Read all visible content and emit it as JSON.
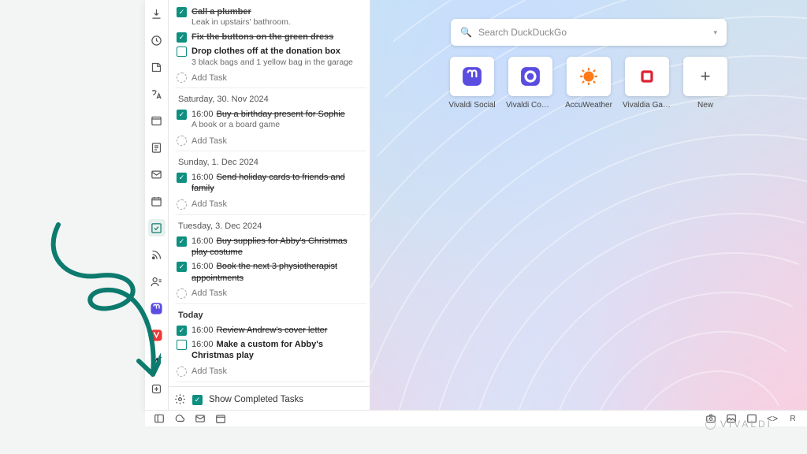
{
  "search": {
    "placeholder": "Search DuckDuckGo"
  },
  "speed_dial": [
    {
      "label": "Vivaldi Social",
      "icon": "mastodon"
    },
    {
      "label": "Vivaldi Com…",
      "icon": "vivaldi"
    },
    {
      "label": "AccuWeather",
      "icon": "sun"
    },
    {
      "label": "Vivaldia Games",
      "icon": "game"
    },
    {
      "label": "New",
      "icon": "plus"
    }
  ],
  "footer": {
    "toggle_label": "Show Completed Tasks",
    "toggle_checked": true
  },
  "add_task_label": "Add Task",
  "branding": "VIVALDI",
  "days": [
    {
      "header": "",
      "tasks": [
        {
          "done": true,
          "time": "",
          "title": "Call a plumber",
          "note": "Leak in upstairs' bathroom."
        },
        {
          "done": true,
          "time": "",
          "title": "Fix the buttons on the green dress",
          "note": ""
        },
        {
          "done": false,
          "time": "",
          "title": "Drop clothes off at the donation box",
          "note": "3 black bags and 1 yellow bag in the garage"
        }
      ]
    },
    {
      "header": "Saturday,  30. Nov 2024",
      "tasks": [
        {
          "done": true,
          "time": "16:00",
          "title": "Buy a birthday present for Sophie",
          "note": "A book or a board game"
        }
      ]
    },
    {
      "header": "Sunday,  1. Dec 2024",
      "tasks": [
        {
          "done": true,
          "time": "16:00",
          "title": "Send holiday cards to friends and family",
          "note": ""
        }
      ]
    },
    {
      "header": "Tuesday,  3. Dec 2024",
      "tasks": [
        {
          "done": true,
          "time": "16:00",
          "title": "Buy supplies for Abby's Christmas play costume",
          "note": ""
        },
        {
          "done": true,
          "time": "16:00",
          "title": "Book the next 3 physiotherapist appointments",
          "note": ""
        }
      ]
    },
    {
      "header": "Today",
      "header_bold": true,
      "tasks": [
        {
          "done": true,
          "time": "16:00",
          "title": "Review Andrew's cover letter",
          "note": ""
        },
        {
          "done": false,
          "time": "16:00",
          "title": "Make a custom for Abby's Christmas play",
          "note": ""
        }
      ]
    }
  ]
}
